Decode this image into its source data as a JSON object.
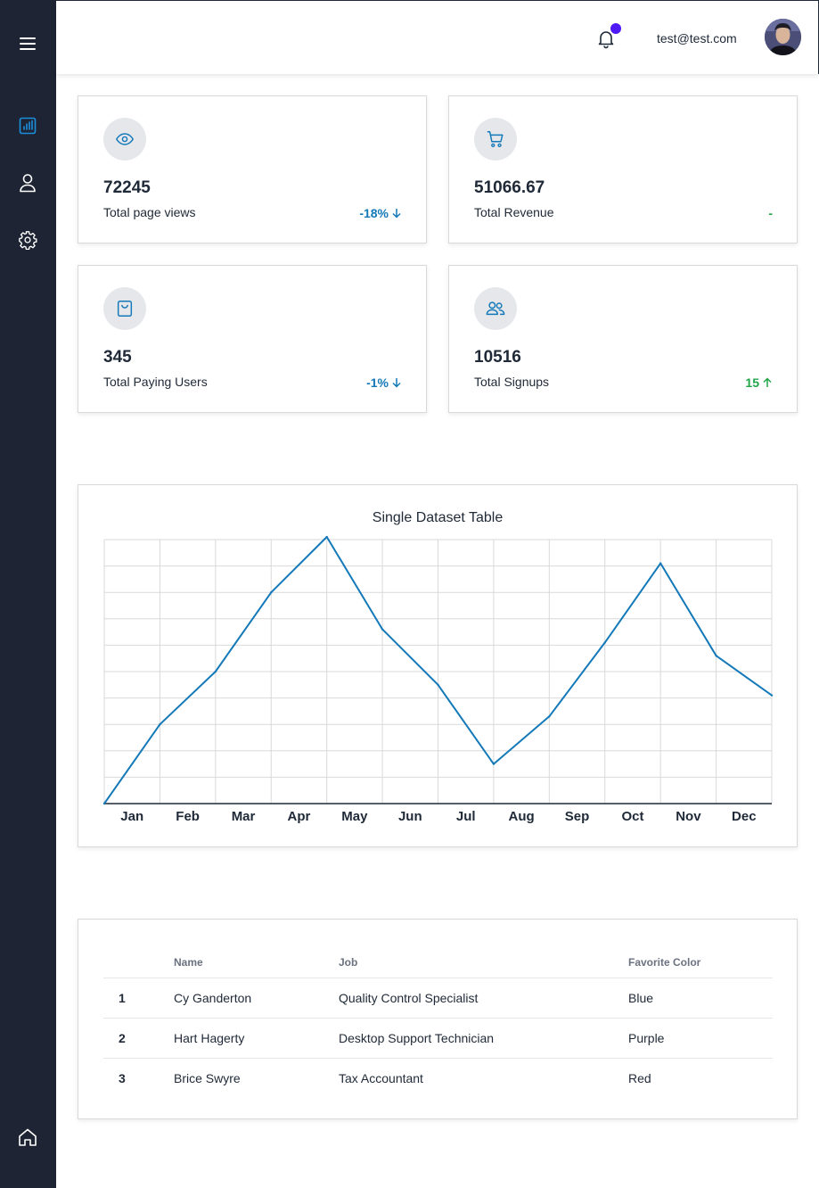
{
  "header": {
    "user_email": "test@test.com"
  },
  "sidebar": {
    "items": [
      {
        "icon": "menu-icon"
      },
      {
        "icon": "chart-bar-icon",
        "active": true
      },
      {
        "icon": "user-icon"
      },
      {
        "icon": "gear-icon"
      },
      {
        "icon": "home-icon"
      }
    ]
  },
  "stats": [
    {
      "icon": "eye-icon",
      "value": "72245",
      "label": "Total page views",
      "change": "-18%",
      "trend": "down",
      "color": "#1479b8"
    },
    {
      "icon": "cart-icon",
      "value": "51066.67",
      "label": "Total Revenue",
      "change": "-",
      "trend": "none",
      "color": "#22a547"
    },
    {
      "icon": "shopping-bag-icon",
      "value": "345",
      "label": "Total Paying Users",
      "change": "-1%",
      "trend": "down",
      "color": "#1479b8"
    },
    {
      "icon": "users-icon",
      "value": "10516",
      "label": "Total Signups",
      "change": "15",
      "trend": "up",
      "color": "#22a547"
    }
  ],
  "chart_data": {
    "type": "line",
    "title": "Single Dataset Table",
    "categories": [
      "Jan",
      "Feb",
      "Mar",
      "Apr",
      "May",
      "Jun",
      "Jul",
      "Aug",
      "Sep",
      "Oct",
      "Nov",
      "Dec"
    ],
    "x": [
      0,
      1,
      2,
      3,
      4,
      5,
      6,
      7,
      8,
      9,
      10,
      11,
      12
    ],
    "values": [
      0,
      30,
      50,
      80,
      101,
      66,
      45,
      15,
      33,
      61,
      91,
      56,
      41
    ],
    "ylim": [
      0,
      100
    ],
    "grid": true,
    "color": "#1479b8"
  },
  "table": {
    "headers": [
      "",
      "Name",
      "Job",
      "Favorite Color"
    ],
    "rows": [
      {
        "num": "1",
        "name": "Cy Ganderton",
        "job": "Quality Control Specialist",
        "color": "Blue"
      },
      {
        "num": "2",
        "name": "Hart Hagerty",
        "job": "Desktop Support Technician",
        "color": "Purple"
      },
      {
        "num": "3",
        "name": "Brice Swyre",
        "job": "Tax Accountant",
        "color": "Red"
      }
    ]
  }
}
